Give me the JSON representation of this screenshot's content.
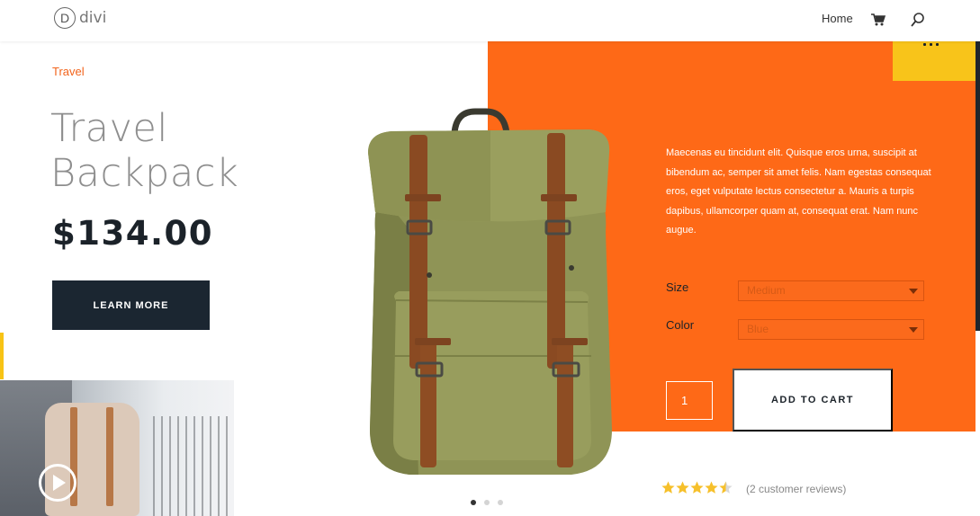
{
  "header": {
    "logo_letter": "D",
    "logo_text": "divi",
    "nav": {
      "home": "Home"
    },
    "icons": [
      "cart-icon",
      "search-icon"
    ]
  },
  "product": {
    "category": "Travel",
    "title": "Travel\nBackpack",
    "price": "$134.00",
    "learn_more": "LEARN MORE",
    "description": "Maecenas eu tincidunt elit. Quisque eros urna, suscipit at bibendum ac, semper sit amet felis. Nam egestas consequat eros, eget vulputate lectus consectetur a. Mauris a turpis dapibus, ullamcorper quam at, consequat erat. Nam nunc augue.",
    "size_label": "Size",
    "size_value": "Medium",
    "color_label": "Color",
    "color_value": "Blue",
    "quantity": "1",
    "add_to_cart": "ADD TO CART",
    "rating": 4.5,
    "rating_max": 5,
    "reviews": "(2 customer reviews)"
  },
  "slider": {
    "slides": 3,
    "active": 1
  },
  "colors": {
    "orange": "#fe6917",
    "yellow": "#f8c41a",
    "dark": "#1b2631",
    "star": "#f6c02b"
  }
}
